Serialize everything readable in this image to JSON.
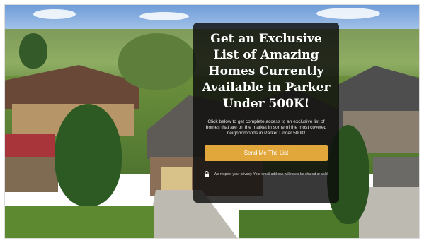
{
  "hero": {
    "headline": "Get an Exclusive List of Amazing Homes Currently Available in Parker Under 500K!",
    "subtext": "Click below to get complete access to an exclusive list of homes that are on the market in some of the most coveted neighborhoods in Parker Under 500K!",
    "cta_label": "Send Me The List",
    "privacy_text": "We respect your privacy. Your email address will never be shared or sold.",
    "privacy_icon": "lock-icon"
  },
  "colors": {
    "card_background": "#0c0c0c",
    "cta": "#e2a73b",
    "text": "#ffffff"
  }
}
